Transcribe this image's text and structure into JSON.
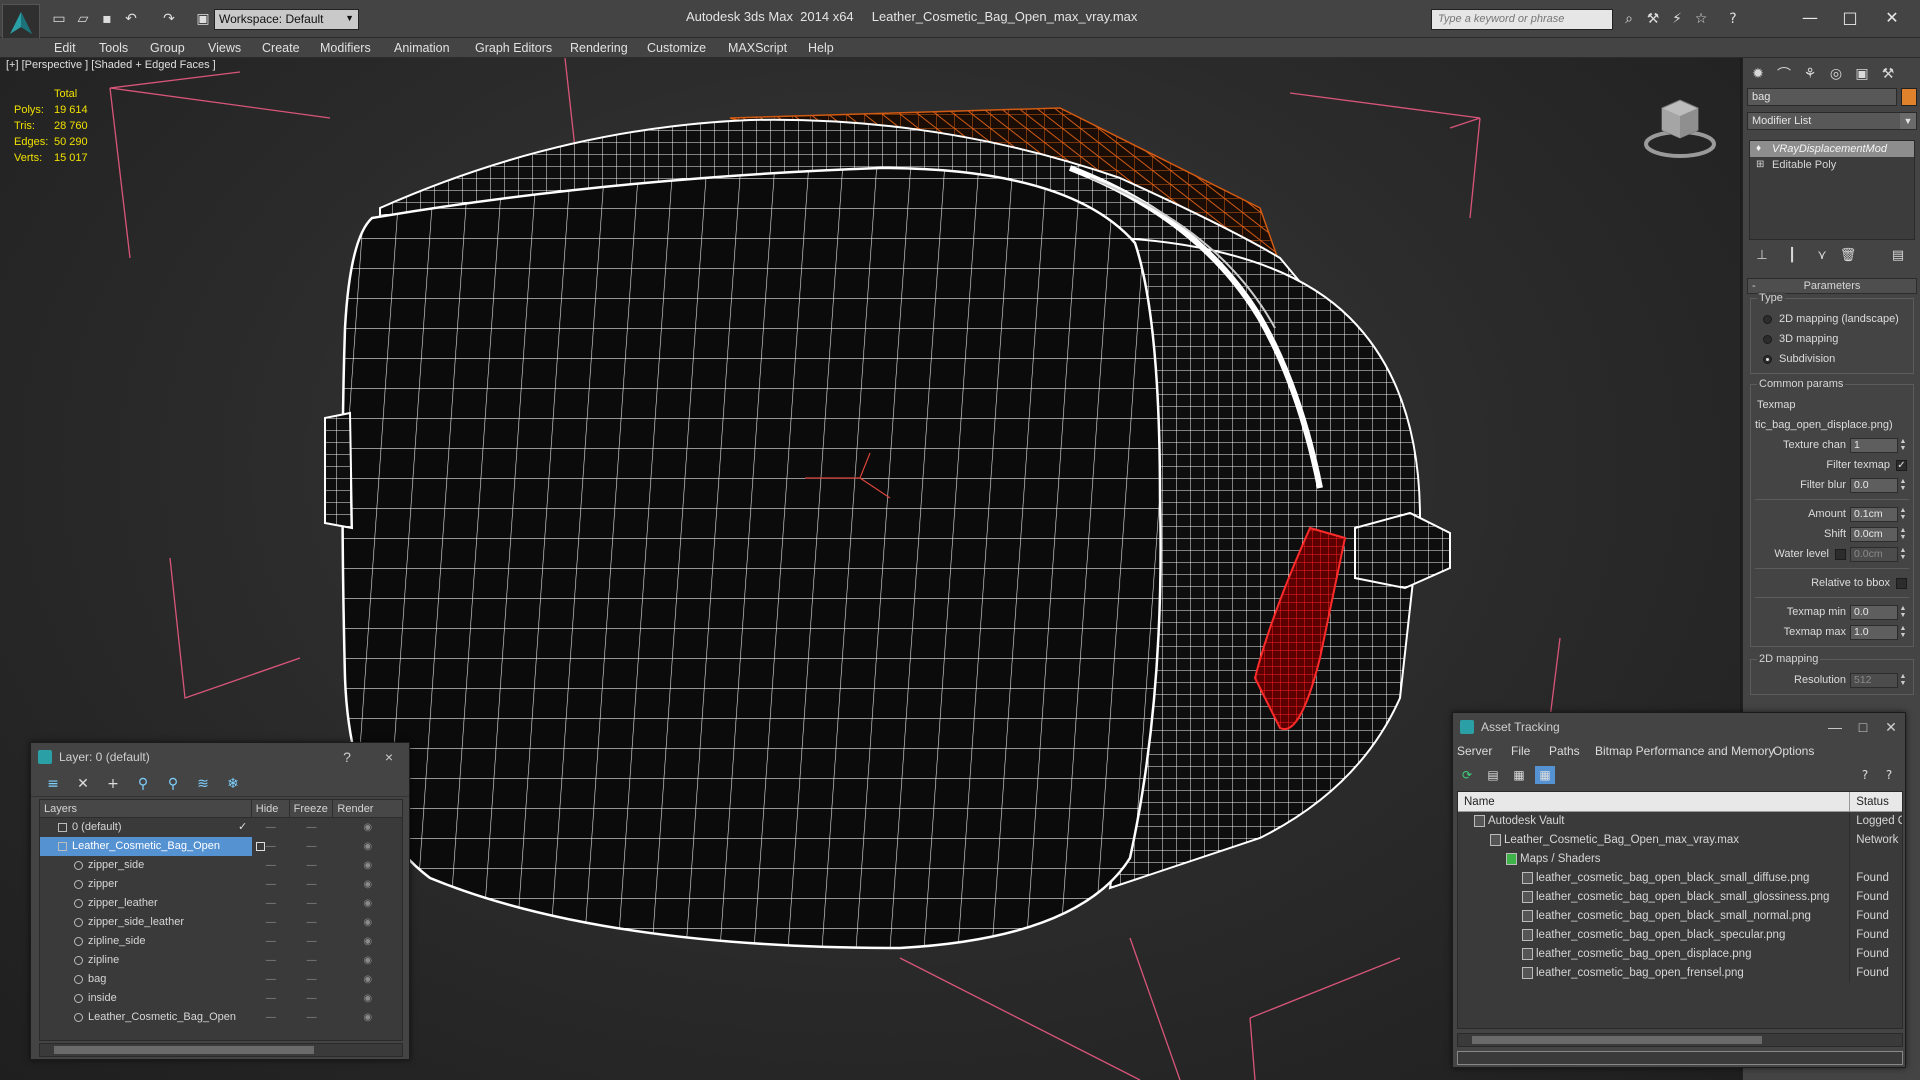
{
  "app": {
    "title": "Autodesk 3ds Max  2014 x64     Leather_Cosmetic_Bag_Open_max_vray.max",
    "workspace": "Workspace: Default",
    "search_placeholder": "Type a keyword or phrase"
  },
  "menu": [
    "Edit",
    "Tools",
    "Group",
    "Views",
    "Create",
    "Modifiers",
    "Animation",
    "Graph Editors",
    "Rendering",
    "Customize",
    "MAXScript",
    "Help"
  ],
  "viewport": {
    "label": "[+] [Perspective ] [Shaded + Edged Faces ]",
    "stats_header": "Total",
    "stats": [
      {
        "k": "Polys:",
        "v": "19 614"
      },
      {
        "k": "Tris:",
        "v": "28 760"
      },
      {
        "k": "Edges:",
        "v": "50 290"
      },
      {
        "k": "Verts:",
        "v": "15 017"
      }
    ]
  },
  "command_panel": {
    "object_name": "bag",
    "object_color": "#e0822b",
    "modifier_list": "Modifier List",
    "stack": [
      "VRayDisplacementMod",
      "Editable Poly"
    ],
    "parameters_title": "Parameters",
    "type_group": "Type",
    "type_options": [
      "2D mapping (landscape)",
      "3D mapping",
      "Subdivision"
    ],
    "common_group": "Common params",
    "texmap_label": "Texmap",
    "texmap_value": "tic_bag_open_displace.png)",
    "texture_chan_label": "Texture chan",
    "texture_chan_value": "1",
    "filter_texmap_label": "Filter texmap",
    "filter_blur_label": "Filter blur",
    "filter_blur_value": "0.0",
    "amount_label": "Amount",
    "amount_value": "0.1cm",
    "shift_label": "Shift",
    "shift_value": "0.0cm",
    "water_level_label": "Water level",
    "water_level_value": "0.0cm",
    "relative_bbox_label": "Relative to bbox",
    "texmap_min_label": "Texmap min",
    "texmap_min_value": "0.0",
    "texmap_max_label": "Texmap max",
    "texmap_max_value": "1.0",
    "mapping_2d_group": "2D mapping",
    "resolution_label": "Resolution",
    "resolution_value": "512"
  },
  "layer_dialog": {
    "title": "Layer: 0 (default)",
    "help": "?",
    "close": "×",
    "columns": [
      "Layers",
      "Hide",
      "Freeze",
      "Render"
    ],
    "rows": [
      {
        "name": "0 (default)",
        "child": false
      },
      {
        "name": "Leather_Cosmetic_Bag_Open",
        "child": false
      },
      {
        "name": "zipper_side",
        "child": true
      },
      {
        "name": "zipper",
        "child": true
      },
      {
        "name": "zipper_leather",
        "child": true
      },
      {
        "name": "zipper_side_leather",
        "child": true
      },
      {
        "name": "zipline_side",
        "child": true
      },
      {
        "name": "zipline",
        "child": true
      },
      {
        "name": "bag",
        "child": true
      },
      {
        "name": "inside",
        "child": true
      },
      {
        "name": "Leather_Cosmetic_Bag_Open",
        "child": true
      }
    ]
  },
  "asset_dialog": {
    "title": "Asset Tracking",
    "menu": [
      "Server",
      "File",
      "Paths",
      "Bitmap Performance and Memory",
      "Options"
    ],
    "columns": [
      "Name",
      "Status"
    ],
    "rows": [
      {
        "name": "Autodesk Vault",
        "status": "Logged O",
        "indent": 1
      },
      {
        "name": "Leather_Cosmetic_Bag_Open_max_vray.max",
        "status": "Network",
        "indent": 2
      },
      {
        "name": "Maps / Shaders",
        "status": "",
        "indent": 3
      },
      {
        "name": "leather_cosmetic_bag_open_black_small_diffuse.png",
        "status": "Found",
        "indent": 4
      },
      {
        "name": "leather_cosmetic_bag_open_black_small_glossiness.png",
        "status": "Found",
        "indent": 4
      },
      {
        "name": "leather_cosmetic_bag_open_black_small_normal.png",
        "status": "Found",
        "indent": 4
      },
      {
        "name": "leather_cosmetic_bag_open_black_specular.png",
        "status": "Found",
        "indent": 4
      },
      {
        "name": "leather_cosmetic_bag_open_displace.png",
        "status": "Found",
        "indent": 4
      },
      {
        "name": "leather_cosmetic_bag_open_frensel.png",
        "status": "Found",
        "indent": 4
      }
    ]
  }
}
